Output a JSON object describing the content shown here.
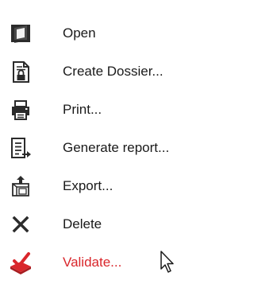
{
  "menu": {
    "items": [
      {
        "label": "Open",
        "icon": "open-folder-icon"
      },
      {
        "label": "Create Dossier...",
        "icon": "locked-document-icon"
      },
      {
        "label": "Print...",
        "icon": "printer-icon"
      },
      {
        "label": "Generate report...",
        "icon": "report-arrow-icon"
      },
      {
        "label": "Export...",
        "icon": "export-box-icon"
      },
      {
        "label": "Delete",
        "icon": "delete-x-icon"
      },
      {
        "label": "Validate...",
        "icon": "validate-check-icon"
      }
    ],
    "validate_color": "#d9262b"
  }
}
